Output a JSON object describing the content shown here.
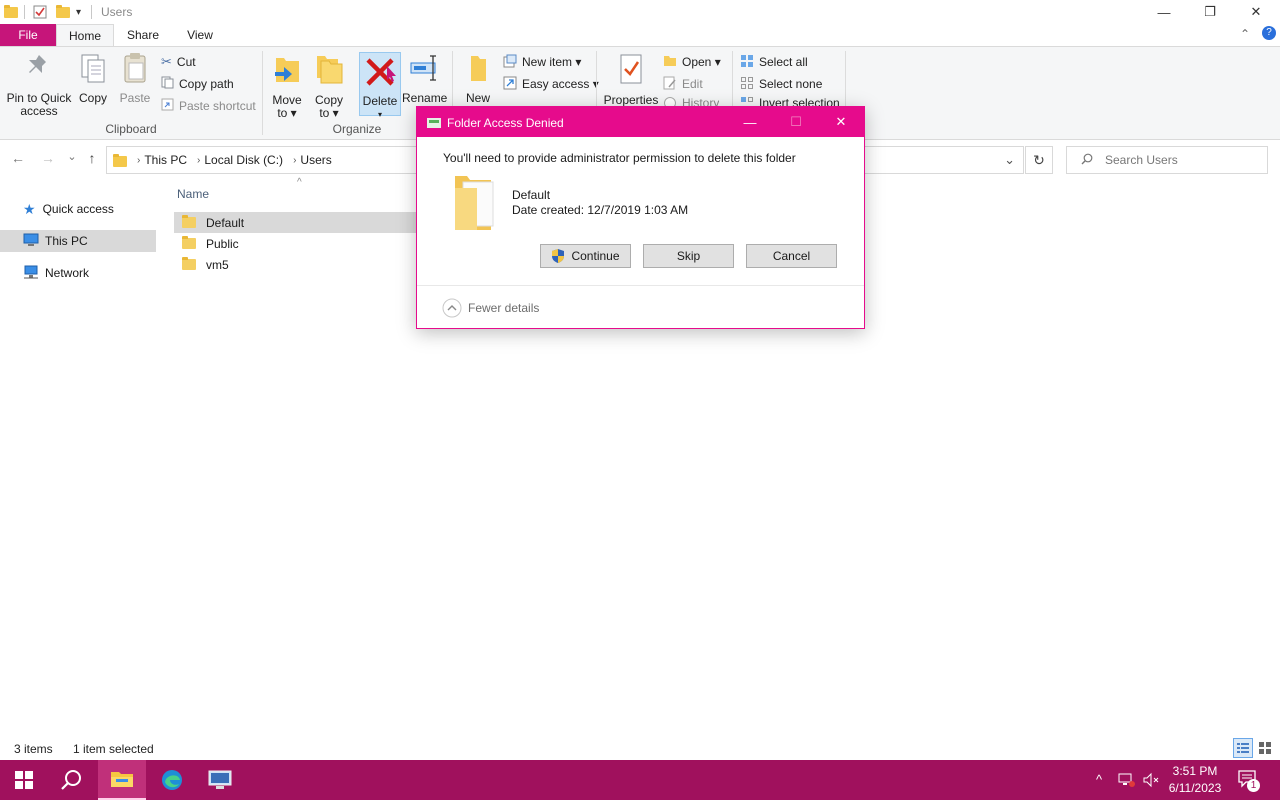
{
  "window": {
    "title": "Users",
    "minimize_glyph": "—",
    "maximize_glyph": "❐",
    "close_glyph": "✕",
    "help_glyph": "?",
    "collapse_glyph": "⌃"
  },
  "ribbon_tabs": [
    "File",
    "Home",
    "Share",
    "View"
  ],
  "ribbon": {
    "clipboard": {
      "pin_label_1": "Pin to Quick",
      "pin_label_2": "access",
      "copy": "Copy",
      "paste": "Paste",
      "cut": "Cut",
      "copy_path": "Copy path",
      "paste_shortcut": "Paste shortcut",
      "group": "Clipboard"
    },
    "organize": {
      "move_to_1": "Move",
      "move_to_2": "to ▾",
      "copy_to_1": "Copy",
      "copy_to_2": "to ▾",
      "delete": "Delete",
      "delete_arrow": "▾",
      "rename": "Rename",
      "group": "Organize"
    },
    "new": {
      "new_folder_1": "New",
      "new_folder_2": "folder",
      "new_item": "New item ▾",
      "easy_access": "Easy access ▾"
    },
    "open": {
      "properties": "Properties",
      "open": "Open ▾",
      "edit": "Edit",
      "history": "History"
    },
    "select": {
      "select_all": "Select all",
      "select_none": "Select none",
      "invert_selection": "Invert selection"
    }
  },
  "address": {
    "crumbs": [
      "This PC",
      "Local Disk (C:)",
      "Users"
    ],
    "search_placeholder": "Search Users",
    "back_glyph": "←",
    "forward_glyph": "→",
    "recent_glyph": "⌄",
    "up_glyph": "↑",
    "refresh_glyph": "↻",
    "dropdown_glyph": "⌄"
  },
  "nav": {
    "items": [
      "Quick access",
      "This PC",
      "Network"
    ],
    "selected": "This PC"
  },
  "files": {
    "column_name": "Name",
    "sort_glyph": "^",
    "rows": [
      "Default",
      "Public",
      "vm5"
    ],
    "selected": "Default"
  },
  "status": {
    "count": "3 items",
    "selection": "1 item selected"
  },
  "dialog": {
    "title": "Folder Access Denied",
    "message": "You'll need to provide administrator permission to delete this folder",
    "folder_name": "Default",
    "date_created": "Date created: 12/7/2019 1:03 AM",
    "continue": "Continue",
    "skip": "Skip",
    "cancel": "Cancel",
    "fewer_details": "Fewer details"
  },
  "taskbar": {
    "time": "3:51 PM",
    "date": "6/11/2023",
    "notification_count": "1",
    "tray_up_glyph": "^"
  },
  "colors": {
    "accent": "#e60b8c",
    "taskbar": "#a0115d",
    "file_tab": "#c6157a"
  }
}
